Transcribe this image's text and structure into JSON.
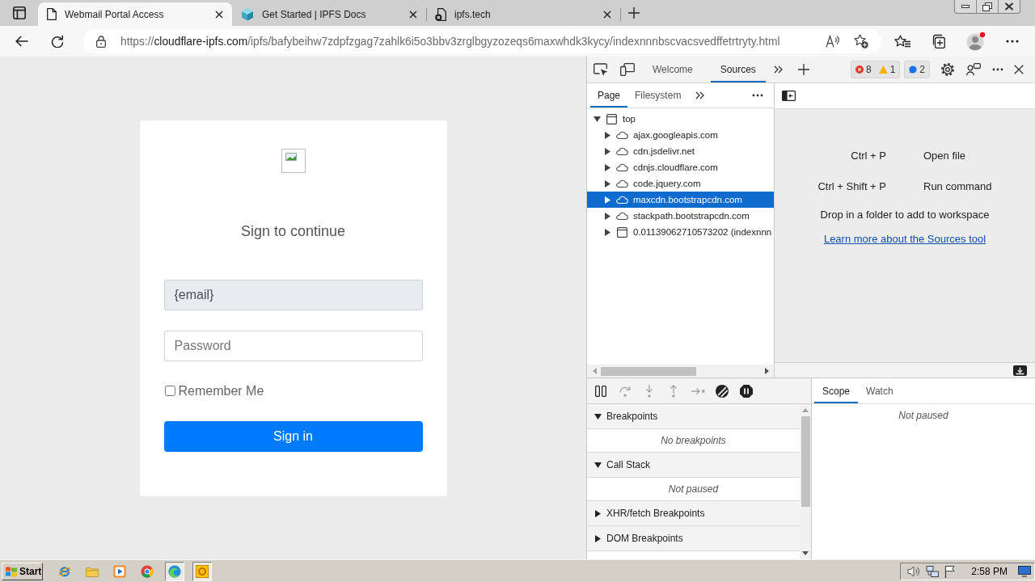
{
  "browser": {
    "tabs": [
      {
        "title": "Webmail Portal Access",
        "kind": "page",
        "selected": true
      },
      {
        "title": "Get Started | IPFS Docs",
        "kind": "cube",
        "selected": false
      },
      {
        "title": "ipfs.tech",
        "kind": "page_error",
        "selected": false
      }
    ],
    "address_bar": {
      "url": {
        "scheme": "https://",
        "host": "cloudflare-ipfs.com",
        "path": "/ipfs/bafybeihw7zdpfzgag7zahlk6i5o3bbv3zrglbgyzozeqs6maxwhdk3kycy/indexnnnbscvacsvedffetrtryty.html"
      }
    }
  },
  "page": {
    "heading": "Sign to continue",
    "email_field": {
      "value": "{email}",
      "disabled": true
    },
    "password_field": {
      "placeholder": "Password"
    },
    "remember_me": {
      "label": "Remember Me",
      "checked": false
    },
    "submit_button": {
      "label": "Sign in"
    }
  },
  "devtools": {
    "tabs": [
      {
        "label": "Welcome",
        "selected": false
      },
      {
        "label": "Sources",
        "selected": true
      }
    ],
    "issues": {
      "errors": "8",
      "warnings": "1",
      "messages": "2"
    },
    "navigator": {
      "tabs": [
        {
          "label": "Page",
          "selected": true
        },
        {
          "label": "Filesystem",
          "selected": false
        }
      ],
      "tree": [
        {
          "label": "top",
          "kind": "frame",
          "expanded": true,
          "selected": false,
          "children": [
            {
              "label": "ajax.googleapis.com",
              "kind": "domain",
              "expanded": false,
              "selected": false
            },
            {
              "label": "cdn.jsdelivr.net",
              "kind": "domain",
              "expanded": false,
              "selected": false
            },
            {
              "label": "cdnjs.cloudflare.com",
              "kind": "domain",
              "expanded": false,
              "selected": false
            },
            {
              "label": "code.jquery.com",
              "kind": "domain",
              "expanded": false,
              "selected": false
            },
            {
              "label": "maxcdn.bootstrapcdn.com",
              "kind": "domain",
              "expanded": false,
              "selected": true
            },
            {
              "label": "stackpath.bootstrapcdn.com",
              "kind": "domain",
              "expanded": false,
              "selected": false
            },
            {
              "label": "0.01139062710573202 (indexnnn",
              "kind": "frame",
              "expanded": false,
              "selected": false
            }
          ]
        }
      ]
    },
    "editor": {
      "shortcuts": [
        {
          "keys": "Ctrl + P",
          "action": "Open file"
        },
        {
          "keys": "Ctrl + Shift + P",
          "action": "Run command"
        }
      ],
      "hint": "Drop in a folder to add to workspace",
      "link": "Learn more about the Sources tool"
    },
    "debugger": {
      "controls": [
        {
          "kind": "pause",
          "disabled": false
        },
        {
          "kind": "step_over",
          "disabled": true
        },
        {
          "kind": "step_into",
          "disabled": true
        },
        {
          "kind": "step_out",
          "disabled": true
        },
        {
          "kind": "step",
          "disabled": true
        },
        {
          "kind": "deactivate",
          "disabled": false
        },
        {
          "kind": "pause_exceptions",
          "disabled": false
        }
      ],
      "sections": [
        {
          "title": "Breakpoints",
          "expanded": true,
          "message": "No breakpoints"
        },
        {
          "title": "Call Stack",
          "expanded": true,
          "message": "Not paused"
        },
        {
          "title": "XHR/fetch Breakpoints",
          "expanded": false
        },
        {
          "title": "DOM Breakpoints",
          "expanded": false
        }
      ],
      "side_tabs": [
        {
          "label": "Scope",
          "selected": true
        },
        {
          "label": "Watch",
          "selected": false
        }
      ],
      "side_message": "Not paused"
    }
  },
  "taskbar": {
    "start_label": "Start",
    "apps": [
      {
        "kind": "e_logo",
        "active": false
      },
      {
        "kind": "folder",
        "active": false
      },
      {
        "kind": "player",
        "active": false
      },
      {
        "kind": "tricolor",
        "active": false
      },
      {
        "kind": "swirl",
        "active": true
      },
      {
        "kind": "o_logo",
        "active": true
      }
    ],
    "clock": "2:58 PM"
  }
}
